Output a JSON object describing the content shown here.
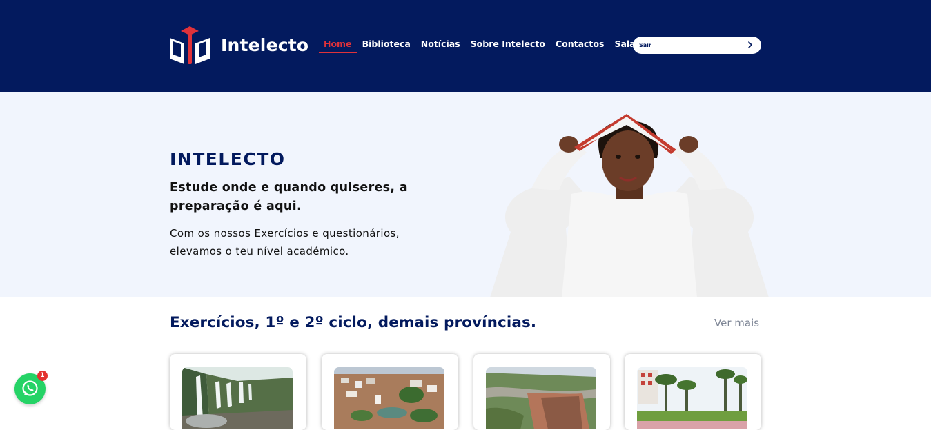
{
  "brand": {
    "name": "Intelecto",
    "icon": "book-cap-logo-icon"
  },
  "nav": {
    "items": [
      {
        "label": "Home",
        "active": true
      },
      {
        "label": "Biblioteca"
      },
      {
        "label": "Notícias"
      },
      {
        "label": "Sobre Intelecto"
      },
      {
        "label": "Contactos"
      },
      {
        "label": "Sala"
      }
    ]
  },
  "search": {
    "placeholder": "Sair",
    "icon": "chevron-right-icon"
  },
  "hero": {
    "title": "INTELECTO",
    "subtitle": "Estude onde e quando quiseres, a preparação é aqui.",
    "text": "Com os nossos Exercícios e questionários, elevamos o teu nível académico."
  },
  "section": {
    "title": "Exercícios, 1º e 2º ciclo, demais províncias.",
    "see_more": "Ver mais"
  },
  "whatsapp": {
    "icon": "whatsapp-icon",
    "badge": "1"
  },
  "colors": {
    "navy": "#031a5e",
    "accent": "#e0323a",
    "hero_bg": "#f1f5fd",
    "whatsapp": "#25d366"
  }
}
